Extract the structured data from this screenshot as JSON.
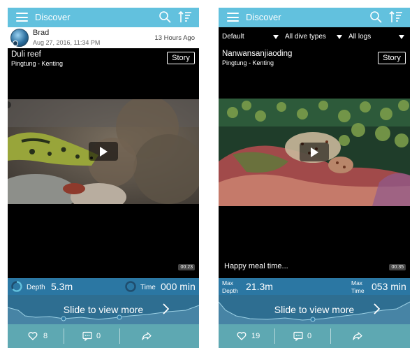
{
  "colors": {
    "navbar": "#62c1de",
    "stats": "#2b77a3",
    "slider": "#2e6e91",
    "actionbar": "#5ea8b2"
  },
  "icons": [
    "menu-icon",
    "search-icon",
    "sort-icon",
    "heart-icon",
    "comment-icon",
    "share-icon",
    "play-icon",
    "chevron-right-icon"
  ],
  "left": {
    "nav_title": "Discover",
    "user": {
      "name": "Brad",
      "date": "Aug 27, 2016, 11:34 PM",
      "ago": "13 Hours Ago"
    },
    "post": {
      "title": "Duli reef",
      "location": "Pingtung - Kenting",
      "story_label": "Story"
    },
    "video": {
      "duration": "00:23"
    },
    "stats": {
      "depth_label": "Depth",
      "depth_value": "5.3m",
      "time_label": "Time",
      "time_value": "000 min"
    },
    "slide_text": "Slide to view more",
    "actions": {
      "likes": "8",
      "comments": "0"
    }
  },
  "right": {
    "nav_title": "Discover",
    "filters": {
      "sort": "Default",
      "dive_types": "All dive types",
      "logs": "All logs"
    },
    "post": {
      "title": "Nanwansanjiaoding",
      "location": "Pingtung - Kenting",
      "story_label": "Story"
    },
    "video": {
      "caption": "Happy meal time...",
      "duration": "00:35"
    },
    "stats": {
      "depth_label_1": "Max",
      "depth_label_2": "Depth",
      "depth_value": "21.3m",
      "time_label_1": "Max",
      "time_label_2": "Time",
      "time_value": "053 min"
    },
    "slide_text": "Slide to view more",
    "actions": {
      "likes": "19",
      "comments": "0"
    }
  }
}
